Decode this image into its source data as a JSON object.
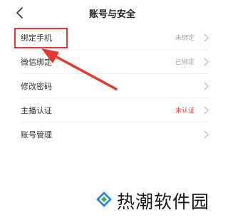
{
  "header": {
    "title": "账号与安全"
  },
  "rows": [
    {
      "label": "绑定手机",
      "status": "未绑定",
      "status_alert": false
    },
    {
      "label": "微信绑定",
      "status": "已绑定",
      "status_alert": false
    },
    {
      "label": "修改密码",
      "status": "",
      "status_alert": false
    },
    {
      "label": "主播认证",
      "status": "未认证",
      "status_alert": true
    },
    {
      "label": "账号管理",
      "status": "",
      "status_alert": false
    }
  ],
  "watermark": {
    "text": "热潮软件园"
  },
  "colors": {
    "annotation_red": "#e23a2e",
    "alert_red": "#e43a3a",
    "status_gray": "#a8a8a8",
    "logo_blue": "#2f86d6",
    "logo_green": "#3ab54a"
  },
  "icons": {
    "back": "chevron-left-icon",
    "row_arrow": "chevron-right-icon",
    "watermark_logo": "diamond-logo-icon"
  }
}
